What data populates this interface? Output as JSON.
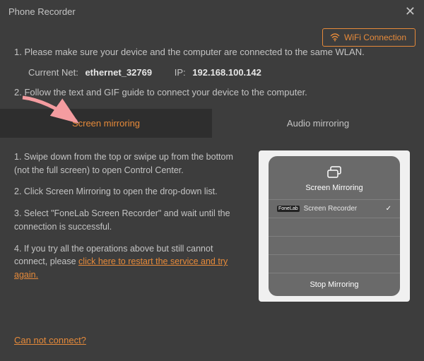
{
  "title": "Phone Recorder",
  "wifi_button": "WiFi Connection",
  "instructions": {
    "step1": "1. Please make sure your device and the computer are connected to the same WLAN.",
    "net_label": "Current Net:",
    "net_value": "ethernet_32769",
    "ip_label": "IP:",
    "ip_value": "192.168.100.142",
    "step2": "2. Follow the text and GIF guide to connect your device to the computer."
  },
  "tabs": {
    "screen": "Screen mirroring",
    "audio": "Audio mirroring"
  },
  "steps": {
    "s1": "1. Swipe down from the top or swipe up from the bottom (not the full screen) to open Control Center.",
    "s2": "2. Click Screen Mirroring to open the drop-down list.",
    "s3": "3. Select \"FoneLab Screen Recorder\" and wait until the connection is successful.",
    "s4a": "4. If you try all the operations above but still cannot connect, please ",
    "s4link": "click here to restart the service and try again."
  },
  "preview": {
    "title": "Screen Mirroring",
    "app": "FoneLab",
    "name": "Screen Recorder",
    "stop": "Stop Mirroring"
  },
  "footer": "Can not connect?"
}
